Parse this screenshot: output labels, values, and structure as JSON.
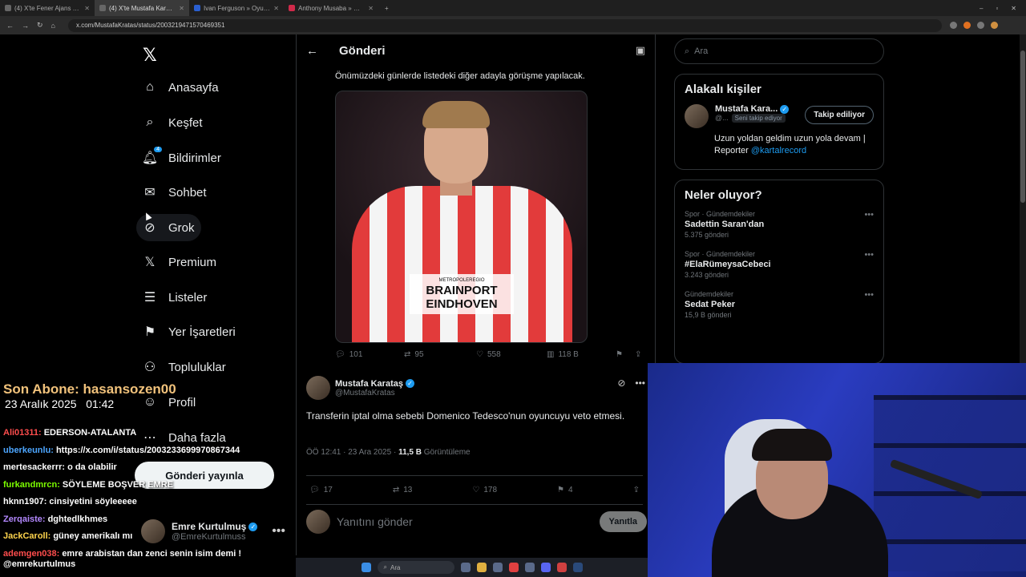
{
  "browser": {
    "tabs": [
      {
        "title": "(4) X'te Fener Ajans ne: \"SON D...",
        "active": false
      },
      {
        "title": "(4) X'te Mustafa Karataş: \"Trans...",
        "active": true
      },
      {
        "title": "Ivan Ferguson » Oyuncu profil...",
        "active": false
      },
      {
        "title": "Anthony Musaba » Welcome I...",
        "active": false
      }
    ],
    "url": "x.com/MustafaKratas/status/2003219471570469351"
  },
  "nav": {
    "items": [
      {
        "label": "Anasayfa",
        "icon": "home-icon"
      },
      {
        "label": "Keşfet",
        "icon": "search-icon"
      },
      {
        "label": "Bildirimler",
        "icon": "bell-icon",
        "badge": "4"
      },
      {
        "label": "Sohbet",
        "icon": "mail-icon"
      },
      {
        "label": "Grok",
        "icon": "grok-icon"
      },
      {
        "label": "Premium",
        "icon": "x-icon"
      },
      {
        "label": "Listeler",
        "icon": "list-icon"
      },
      {
        "label": "Yer İşaretleri",
        "icon": "bookmark-icon"
      },
      {
        "label": "Topluluklar",
        "icon": "communities-icon"
      },
      {
        "label": "Profil",
        "icon": "profile-icon"
      },
      {
        "label": "Daha fazla",
        "icon": "more-icon"
      }
    ],
    "post_button": "Gönderi yayınla",
    "account": {
      "name": "Emre Kurtulmuş",
      "handle": "@EmreKurtulmuss"
    }
  },
  "main": {
    "title": "Gönderi",
    "quoted_text": "Önümüzdeki günlerde listedeki diğer adayla görüşme yapılacak.",
    "media": {
      "sponsor_small": "METROPOLEREGIO",
      "sponsor_line1": "BRAINPORT",
      "sponsor_line2": "EINDHOVEN"
    },
    "quoted_stats": {
      "replies": "101",
      "reposts": "95",
      "likes": "558",
      "views": "118 B"
    },
    "tweet": {
      "name": "Mustafa Karataş",
      "handle": "@MustafaKratas",
      "text": "Transferin iptal olma sebebi Domenico Tedesco'nun oyuncuyu veto etmesi.",
      "time": "ÖÖ 12:41 · 23 Ara 2025 · ",
      "views_count": "11,5 B",
      "views_label": " Görüntüleme",
      "stats": {
        "replies": "17",
        "reposts": "13",
        "likes": "178",
        "bookmarks": "4"
      }
    },
    "reply": {
      "placeholder": "Yanıtını gönder",
      "button": "Yanıtla"
    }
  },
  "sidebar": {
    "search_placeholder": "Ara",
    "related": {
      "title": "Alakalı kişiler",
      "name": "Mustafa Kara...",
      "handle": "@...",
      "follows_you": "Seni takip ediyor",
      "follow_button": "Takip ediliyor",
      "bio": "Uzun yoldan geldim uzun yola devam | Reporter ",
      "bio_link": "@kartalrecord"
    },
    "trends": {
      "title": "Neler oluyor?",
      "items": [
        {
          "category": "Spor · Gündemdekiler",
          "name": "Sadettin Saran'dan",
          "count": "5.375 gönderi"
        },
        {
          "category": "Spor · Gündemdekiler",
          "name": "#ElaRümeysaCebeci",
          "count": "3.243 gönderi"
        },
        {
          "category": "Gündemdekiler",
          "name": "Sedat Peker",
          "count": "15,9 B gönderi"
        }
      ]
    }
  },
  "overlay": {
    "last_sub": "Son Abone: hasansozen00",
    "date": "23 Aralık 2025",
    "time": "01:42",
    "messages": [
      {
        "user": "Ali01311:",
        "text": "EDERSON-ATALANTA",
        "color": "#ff4d4d"
      },
      {
        "user": "uberkeunlu:",
        "text": "https://x.com/i/status/2003233699970867344",
        "color": "#4da6ff"
      },
      {
        "user": "mertesackerrr:",
        "text": "o da olabilir",
        "color": "#ffffff"
      },
      {
        "user": "furkandmrcn:",
        "text": "SÖYLEME BOŞVER EMRE",
        "color": "#7CFC00"
      },
      {
        "user": "hknn1907:",
        "text": "cinsiyetini söyleeeee",
        "color": "#ffffff"
      },
      {
        "user": "Zerqaiste:",
        "text": "dghtedlkhmes",
        "color": "#b388ff"
      },
      {
        "user": "JackCaroll:",
        "text": "güney amerikalı mı",
        "color": "#ffd54d"
      },
      {
        "user": "ademgen038:",
        "text": "emre arabistan dan zenci senin isim demi !",
        "color": "#ff4d4d"
      }
    ],
    "channel_user": "@emrekurtulmus"
  },
  "taskbar": {
    "search": "Ara"
  }
}
